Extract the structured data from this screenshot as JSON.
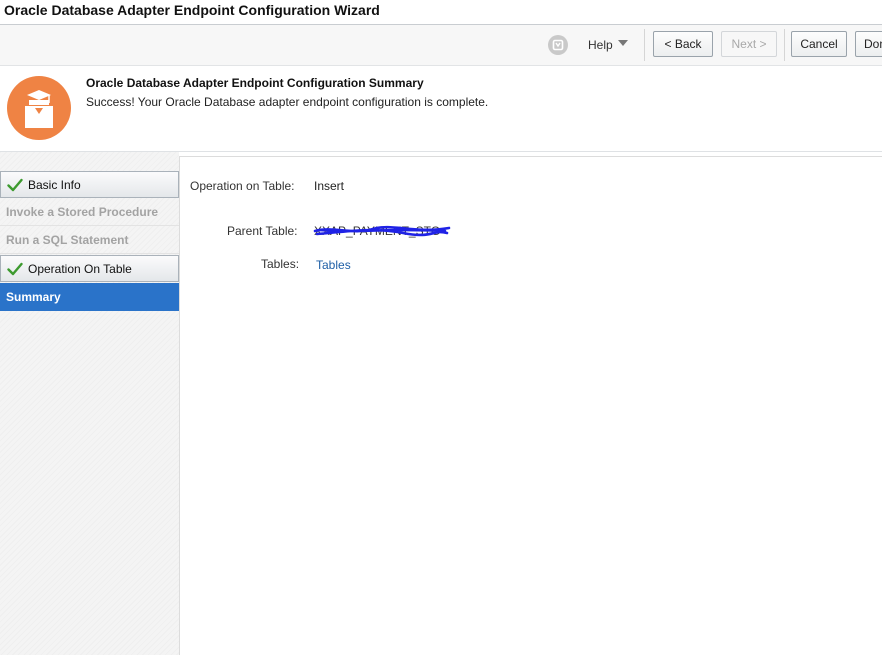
{
  "window": {
    "title": "Oracle Database Adapter Endpoint Configuration Wizard"
  },
  "toolbar": {
    "help_label": "Help",
    "back_label": "< Back",
    "next_label": "Next >",
    "cancel_label": "Cancel",
    "done_label": "Done"
  },
  "header": {
    "title": "Oracle Database Adapter Endpoint Configuration Summary",
    "message": "Success! Your Oracle Database adapter endpoint configuration is complete.",
    "icon": "train-stop-icon",
    "icon_color": "#ef8344"
  },
  "steps": [
    {
      "label": "Basic Info",
      "state": "done"
    },
    {
      "label": "Invoke a Stored Procedure",
      "state": "disabled"
    },
    {
      "label": "Run a SQL Statement",
      "state": "disabled"
    },
    {
      "label": "Operation On Table",
      "state": "done"
    },
    {
      "label": "Summary",
      "state": "active"
    }
  ],
  "summary": {
    "operation_label": "Operation on Table:",
    "operation_value": "Insert",
    "parent_table_label": "Parent Table:",
    "parent_table_value": "XXAP_PAYMENT_STG",
    "tables_label": "Tables:",
    "tables_link": "Tables"
  },
  "colors": {
    "accent": "#2a73c9",
    "check": "#3d9a2f",
    "link": "#1f5fa6",
    "redaction": "#1f22e6"
  }
}
